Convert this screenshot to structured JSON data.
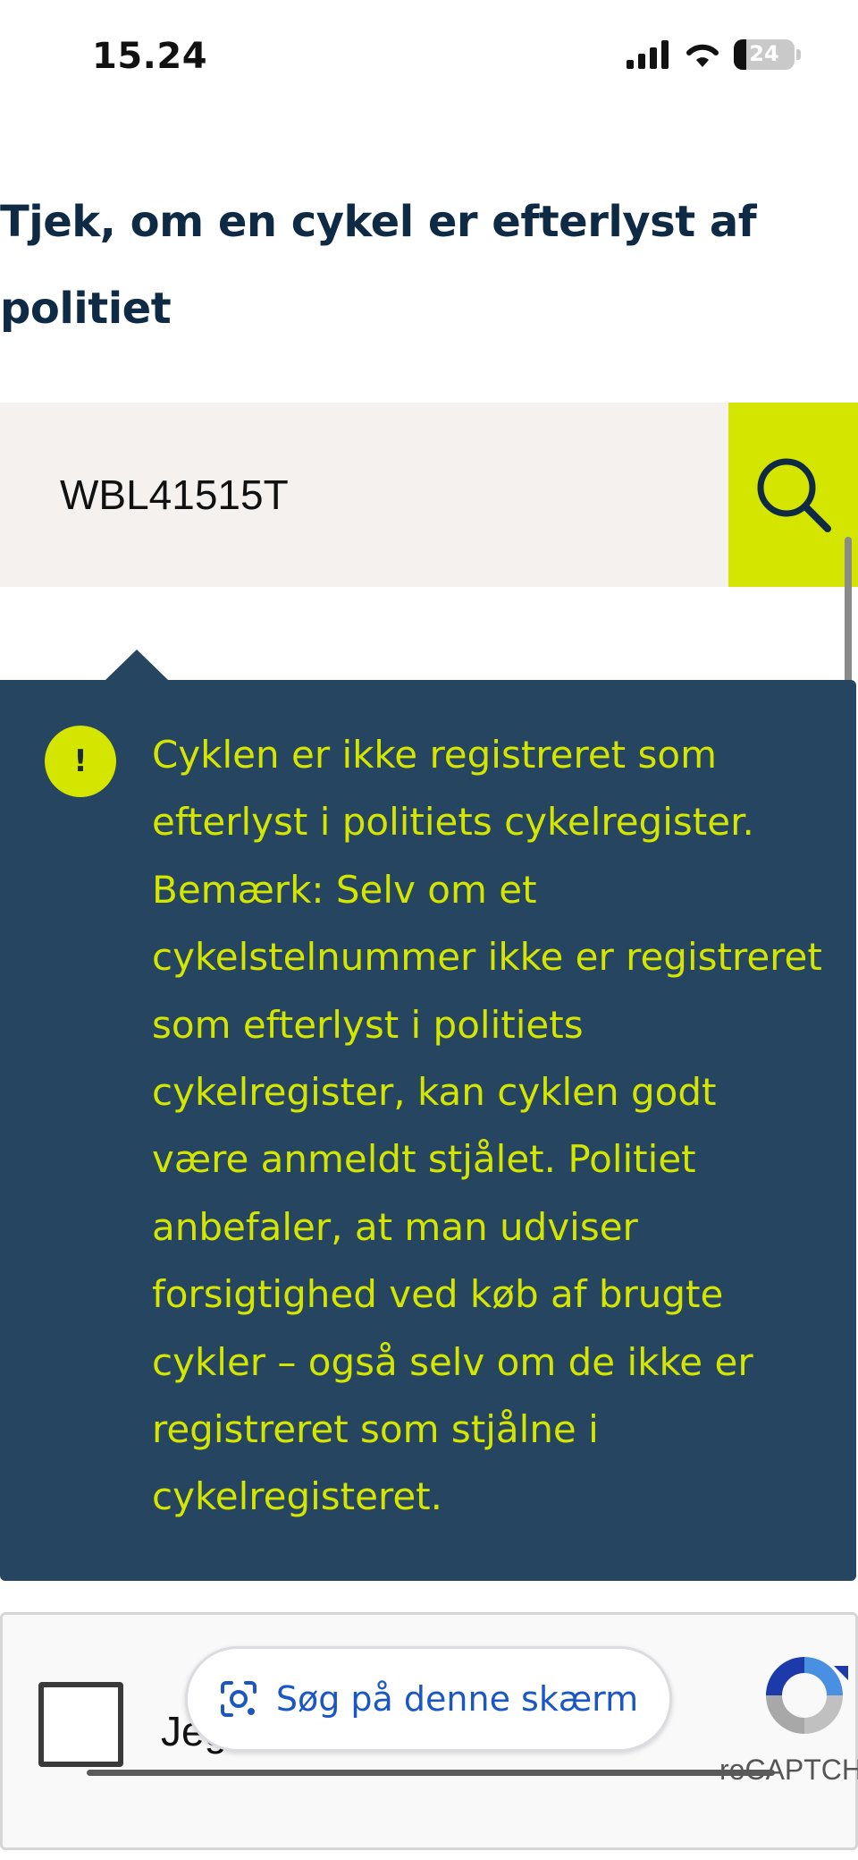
{
  "status_bar": {
    "time": "15.24",
    "battery_level": "24",
    "icons": [
      "signal-icon",
      "wifi-icon",
      "battery-icon"
    ]
  },
  "page": {
    "title": "Tjek, om en cykel er efterlyst af politiet"
  },
  "search": {
    "value": "WBL41515T",
    "button_icon": "search-icon",
    "button_color": "#d4e600"
  },
  "alert": {
    "icon_text": "!",
    "message": "Cyklen er ikke registreret som efterlyst i politiets cykelregister. Bemærk: Selv om et cykelstelnummer ikke er registreret som efterlyst i politiets cykelregister, kan cyklen godt være anmeldt stjålet. Politiet anbefaler, at man udviser forsigtighed ved køb af brugte cykler – også selv om de ikke er registreret som stjålne i cykelregisteret.",
    "background_color": "#254560",
    "text_color": "#d4e600"
  },
  "captcha": {
    "label": "Jeg",
    "brand_text": "reCAPTCHA"
  },
  "lens": {
    "label": "Søg på denne skærm"
  }
}
